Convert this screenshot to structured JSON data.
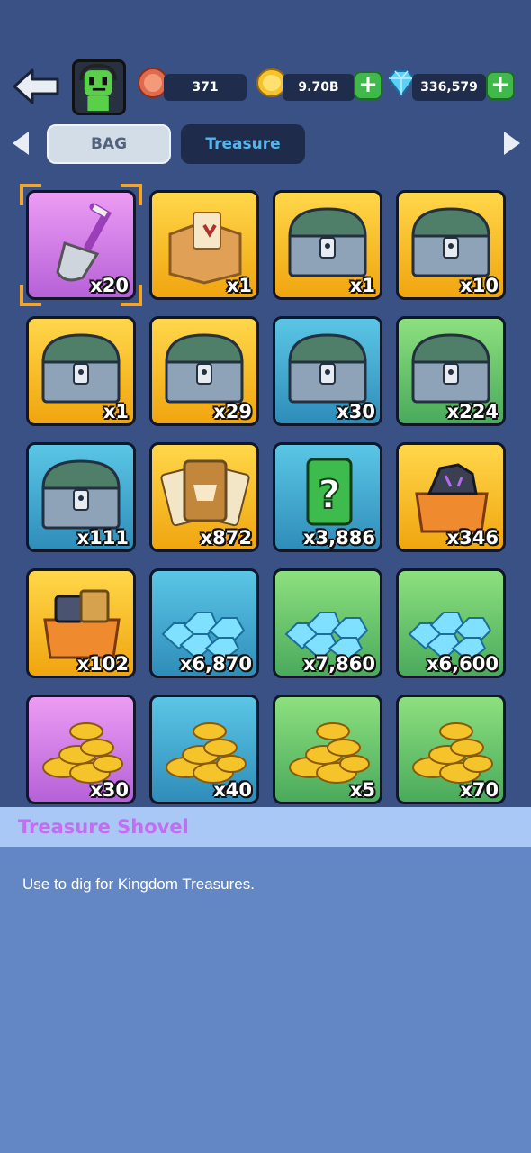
{
  "header": {
    "medal_value": "371",
    "gold_value": "9.70B",
    "gems_value": "336,579",
    "plus_label": "+"
  },
  "tabs": [
    {
      "label": "BAG",
      "selected": false
    },
    {
      "label": "Treasure",
      "selected": true
    }
  ],
  "items": [
    {
      "name": "treasure-shovel",
      "icon": "shovel-icon",
      "bg": "purple",
      "count": "x20",
      "selected": true
    },
    {
      "name": "card-box",
      "icon": "card-box-icon",
      "bg": "gold",
      "count": "x1"
    },
    {
      "name": "silver-green-chest",
      "icon": "chest-icon",
      "bg": "gold",
      "count": "x1"
    },
    {
      "name": "silver-green-chest-2",
      "icon": "chest-icon",
      "bg": "gold",
      "count": "x10"
    },
    {
      "name": "purple-gold-chest",
      "icon": "chest-icon",
      "bg": "gold",
      "count": "x1"
    },
    {
      "name": "gold-chest",
      "icon": "chest-icon",
      "bg": "gold",
      "count": "x29"
    },
    {
      "name": "blue-silver-chest",
      "icon": "chest-icon",
      "bg": "blue",
      "count": "x30"
    },
    {
      "name": "wooden-chest",
      "icon": "chest-icon",
      "bg": "green",
      "count": "x224"
    },
    {
      "name": "blue-chest",
      "icon": "chest-icon",
      "bg": "blue",
      "count": "x111"
    },
    {
      "name": "hero-cards",
      "icon": "cards-icon",
      "bg": "gold",
      "count": "x872"
    },
    {
      "name": "mystery-card",
      "icon": "question-card-icon",
      "bg": "blue",
      "count": "x3,886"
    },
    {
      "name": "rune-stone-box",
      "icon": "rune-box-icon",
      "bg": "gold",
      "count": "x346"
    },
    {
      "name": "material-box",
      "icon": "material-box-icon",
      "bg": "gold",
      "count": "x102"
    },
    {
      "name": "gem-pile-1",
      "icon": "gem-pile-icon",
      "bg": "blue",
      "count": "x6,870"
    },
    {
      "name": "gem-pile-2",
      "icon": "gem-pile-icon",
      "bg": "green",
      "count": "x7,860"
    },
    {
      "name": "gem-pile-3",
      "icon": "gem-pile-icon",
      "bg": "green",
      "count": "x6,600"
    },
    {
      "name": "gold-coins-1",
      "icon": "coin-pile-icon",
      "bg": "purple",
      "count": "x30"
    },
    {
      "name": "gold-coins-2",
      "icon": "coin-pile-icon",
      "bg": "blue",
      "count": "x40"
    },
    {
      "name": "gold-coins-3",
      "icon": "coin-pile-icon",
      "bg": "green",
      "count": "x5"
    },
    {
      "name": "gold-coins-4",
      "icon": "coin-pile-icon",
      "bg": "green",
      "count": "x70"
    }
  ],
  "detail": {
    "title": "Treasure Shovel",
    "description": "Use to dig for Kingdom Treasures."
  },
  "colors": {
    "background": "#3a5186",
    "gold_tile": "#f5b51e",
    "purple_tile": "#c97ae2",
    "blue_tile": "#3fa6cf",
    "green_tile": "#62bf69",
    "selection": "#f4a62a",
    "plus_button": "#3fb94a",
    "detail_title": "#c36df0",
    "detail_header": "#a9c8f5",
    "detail_body": "#6387c4"
  }
}
